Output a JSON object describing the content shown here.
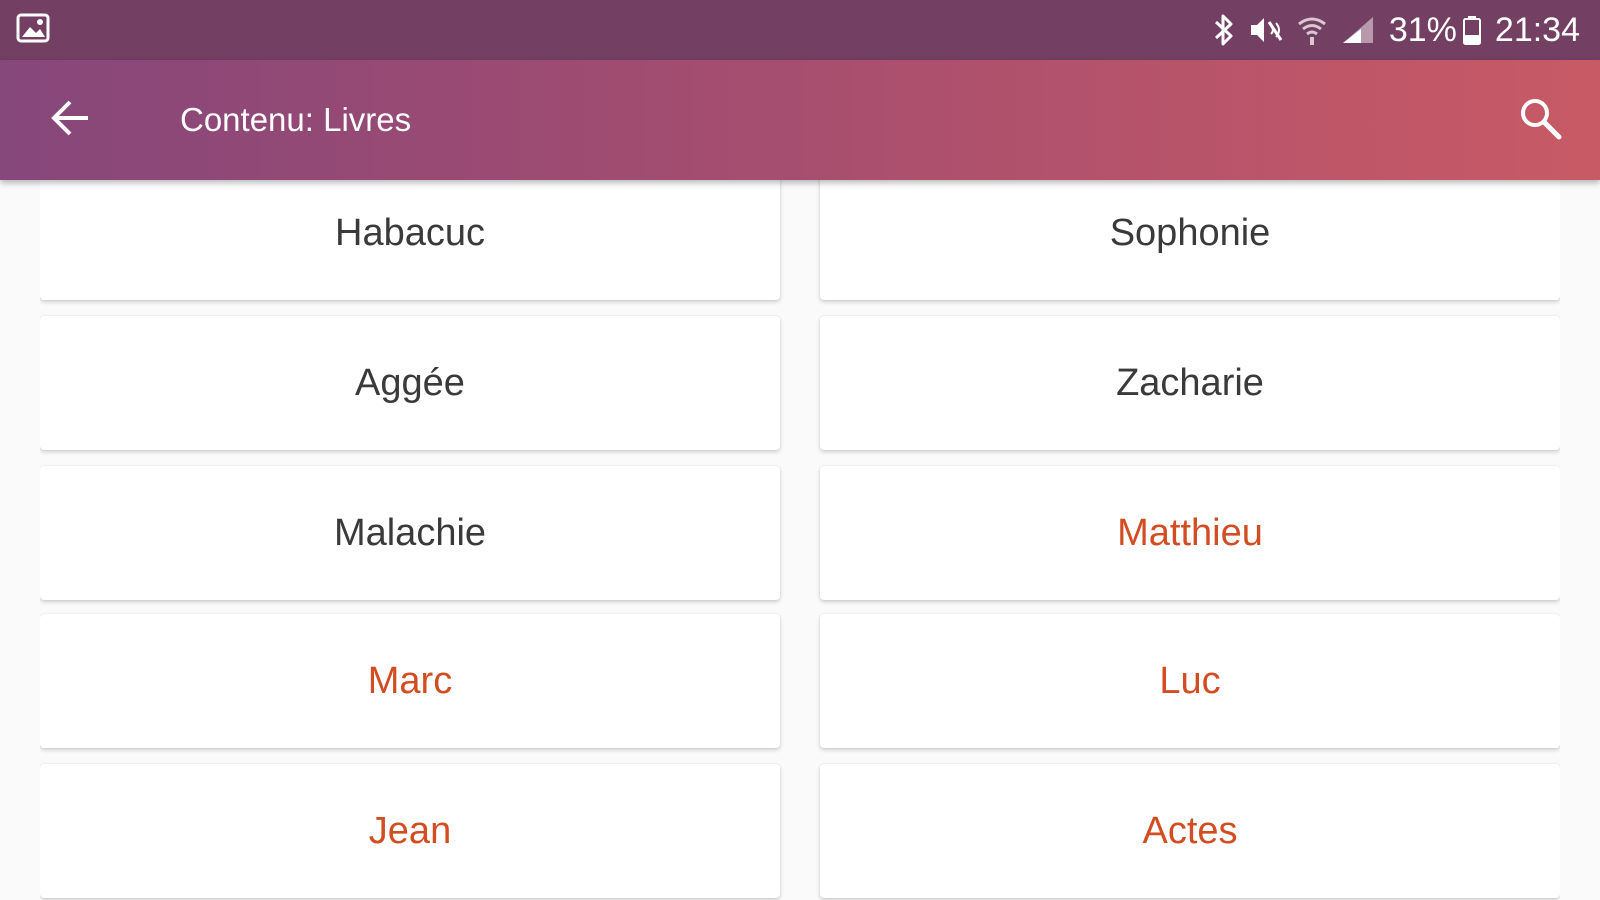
{
  "status_bar": {
    "battery": "31%",
    "time": "21:34",
    "icons": [
      "gallery-notification-icon",
      "bluetooth-icon",
      "mute-vibrate-icon",
      "wifi-icon",
      "cell-signal-icon",
      "battery-icon"
    ]
  },
  "app_bar": {
    "title": "Contenu: Livres",
    "icons": [
      "back-arrow-icon",
      "search-icon"
    ]
  },
  "colors": {
    "old_testament_text": "#3a3a3a",
    "new_testament_text": "#d24d21",
    "status_bar_bg": "#733f62"
  },
  "books": [
    {
      "name": "Habacuc",
      "testament": "old"
    },
    {
      "name": "Sophonie",
      "testament": "old"
    },
    {
      "name": "Aggée",
      "testament": "old"
    },
    {
      "name": "Zacharie",
      "testament": "old"
    },
    {
      "name": "Malachie",
      "testament": "old"
    },
    {
      "name": "Matthieu",
      "testament": "new"
    },
    {
      "name": "Marc",
      "testament": "new"
    },
    {
      "name": "Luc",
      "testament": "new"
    },
    {
      "name": "Jean",
      "testament": "new"
    },
    {
      "name": "Actes",
      "testament": "new"
    }
  ]
}
